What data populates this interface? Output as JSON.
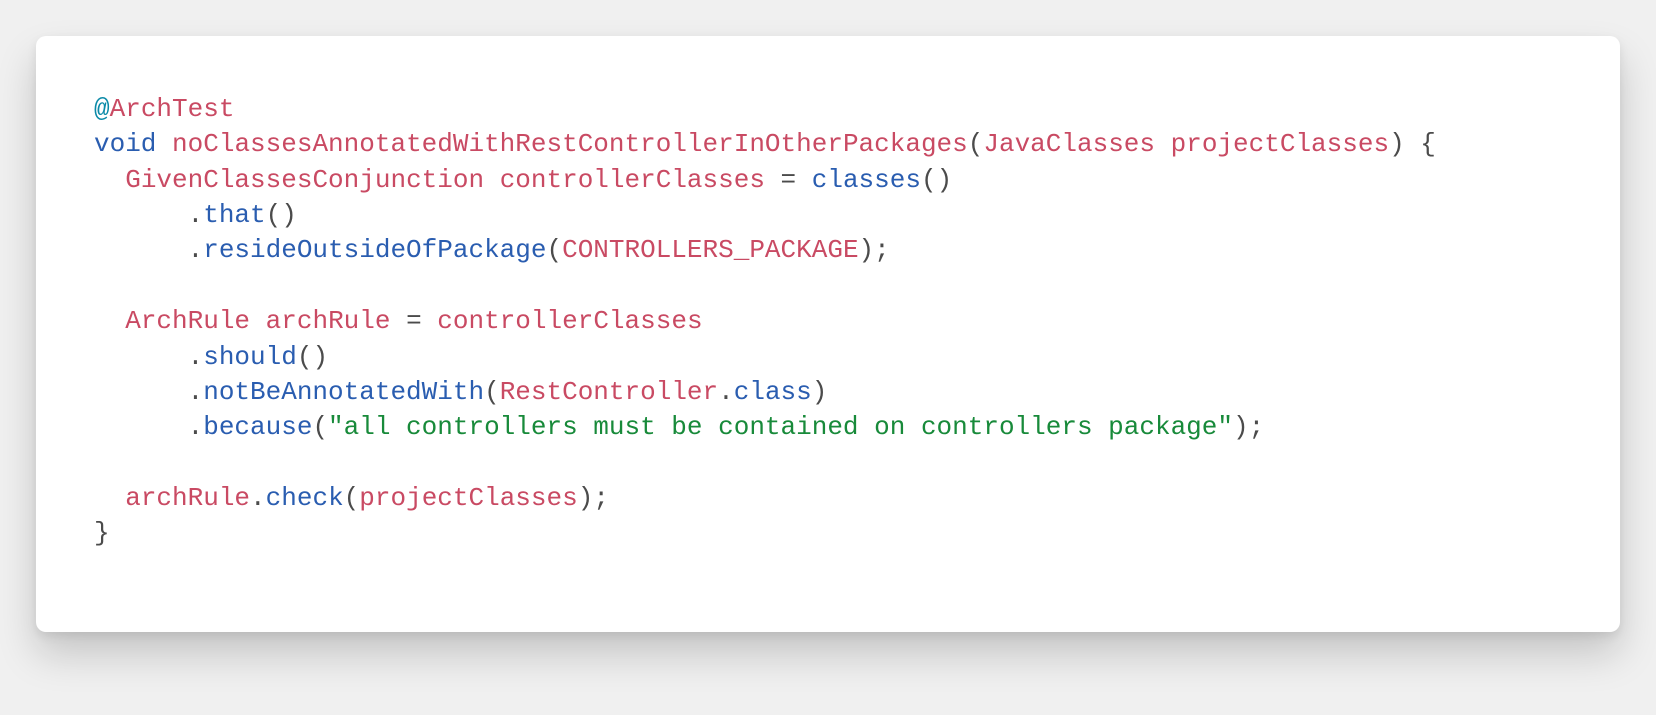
{
  "code": {
    "line1": {
      "at": "@",
      "annotation": "ArchTest"
    },
    "line2": {
      "kw_void": "void",
      "func": "noClassesAnnotatedWithRestControllerInOtherPackages",
      "lp": "(",
      "ptype": "JavaClasses",
      "pname": "projectClasses",
      "rp_brace": ") {"
    },
    "line3": {
      "indent": "  ",
      "type1": "GivenClassesConjunction",
      "var1": "controllerClasses",
      "eq": " = ",
      "call1": "classes",
      "paren1": "()"
    },
    "line4": {
      "indent": "      .",
      "call1": "that",
      "paren1": "()"
    },
    "line5": {
      "indent": "      .",
      "call1": "resideOutsideOfPackage",
      "lp": "(",
      "const1": "CONTROLLERS_PACKAGE",
      "rp": ");"
    },
    "line6": {
      "indent": "  ",
      "type1": "ArchRule",
      "var1": "archRule",
      "eq": " = ",
      "var2": "controllerClasses"
    },
    "line7": {
      "indent": "      .",
      "call1": "should",
      "paren1": "()"
    },
    "line8": {
      "indent": "      .",
      "call1": "notBeAnnotatedWith",
      "lp": "(",
      "type1": "RestController",
      "dot": ".",
      "kw_class": "class",
      "rp": ")"
    },
    "line9": {
      "indent": "      .",
      "call1": "because",
      "lp": "(",
      "str1": "\"all controllers must be contained on controllers package\"",
      "rp": ");"
    },
    "line10": {
      "indent": "  ",
      "var1": "archRule",
      "dot": ".",
      "call1": "check",
      "lp": "(",
      "var2": "projectClasses",
      "rp": ");"
    },
    "line11": {
      "brace": "}"
    }
  }
}
